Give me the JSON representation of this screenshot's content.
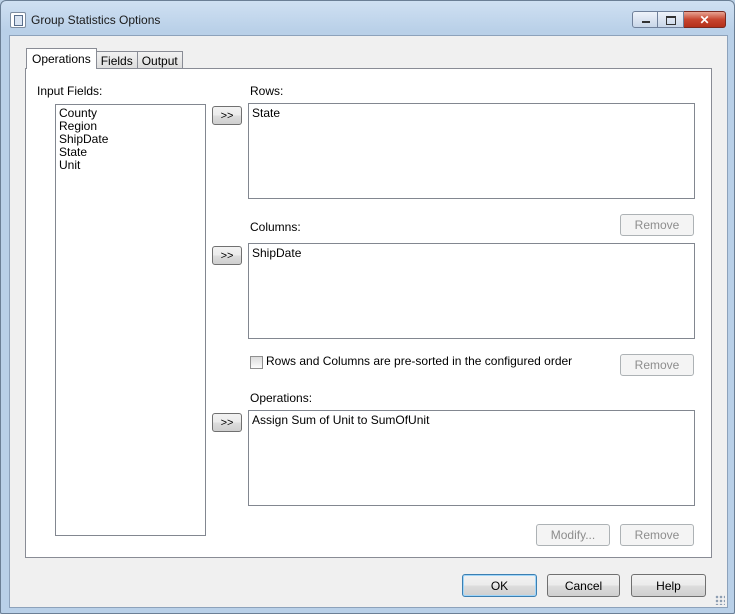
{
  "window": {
    "title": "Group Statistics Options"
  },
  "tabs": [
    {
      "label": "Operations"
    },
    {
      "label": "Fields"
    },
    {
      "label": "Output"
    }
  ],
  "input_fields": {
    "label": "Input Fields:",
    "items": [
      "County",
      "Region",
      "ShipDate",
      "State",
      "Unit"
    ]
  },
  "add_button_label": ">>",
  "rows": {
    "label": "Rows:",
    "items": [
      "State"
    ],
    "remove_label": "Remove"
  },
  "columns": {
    "label": "Columns:",
    "items": [
      "ShipDate"
    ],
    "remove_label": "Remove"
  },
  "presorted": {
    "label": "Rows and Columns are pre-sorted in the configured order",
    "checked": false
  },
  "operations": {
    "label": "Operations:",
    "items": [
      "Assign Sum of Unit to SumOfUnit"
    ],
    "modify_label": "Modify...",
    "remove_label": "Remove"
  },
  "footer": {
    "ok_label": "OK",
    "cancel_label": "Cancel",
    "help_label": "Help"
  }
}
